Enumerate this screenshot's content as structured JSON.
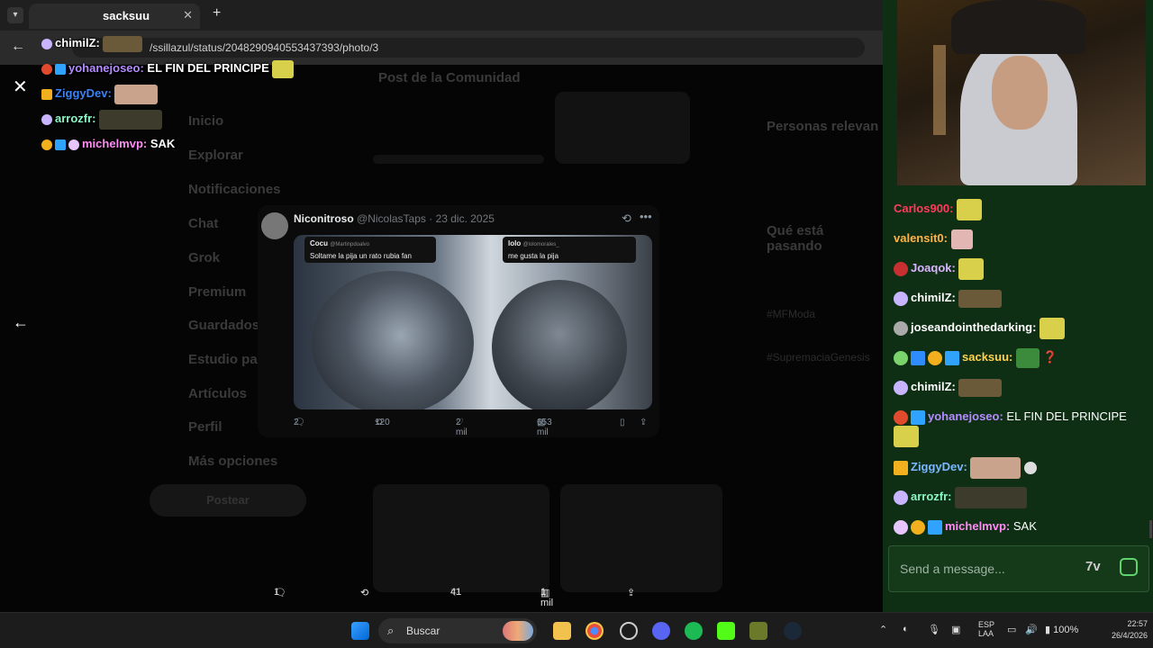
{
  "browser": {
    "tab_title": "sacksuu",
    "new_tab": "+",
    "url": "/ssillazul/status/2048290940553437393/photo/3"
  },
  "x_page": {
    "sidebar": [
      "Inicio",
      "Explorar",
      "Notificaciones",
      "Chat",
      "Grok",
      "Premium",
      "Guardados",
      "Estudio pa",
      "Artículos",
      "Perfil",
      "Más opciones"
    ],
    "post_button": "Postear",
    "community_title": "Post de la Comunidad",
    "right_titles": [
      "Personas relevan",
      "Qué está pasando"
    ],
    "trend_tags": [
      "#MFModa",
      "#SupremaciaGenesis"
    ]
  },
  "tweet": {
    "name": "Niconitroso",
    "handle": "@NicolasTaps",
    "date": "· 23 dic. 2025",
    "image": {
      "left_name": "Cocu",
      "left_handle": "@Martinpdoalvo",
      "left_text": "Soltame la pija un rato rubia fan",
      "right_name": "lolo",
      "right_handle": "@lolomorales_",
      "right_text": "me gusta la pija"
    },
    "replies": "2",
    "reposts": "120",
    "likes": "2 mil",
    "views": "653 mil"
  },
  "post_actions": {
    "replies": "1",
    "likes": "41",
    "views": "1 mil"
  },
  "overlay_chat": [
    {
      "user": "chimilZ:",
      "color": "#ffffff",
      "msg": ""
    },
    {
      "user": "yohanejoseo:",
      "color": "#b48cff",
      "msg": "EL FIN DEL PRINCIPE"
    },
    {
      "user": "ZiggyDev:",
      "color": "#3b82f6",
      "msg": ""
    },
    {
      "user": "arrozfr:",
      "color": "#8cf5c4",
      "msg": ""
    },
    {
      "user": "michelmvp:",
      "color": "#ff8cf5",
      "msg": "SAK"
    }
  ],
  "chat": [
    {
      "user": "Carlos900:",
      "color": "#ff3b5c",
      "msg": ""
    },
    {
      "user": "valensit0:",
      "color": "#ffb347",
      "msg": ""
    },
    {
      "user": "Joaqok:",
      "color": "#d8b4ff",
      "msg": ""
    },
    {
      "user": "chimilZ:",
      "color": "#ffffff",
      "msg": ""
    },
    {
      "user": "joseandointhedarking:",
      "color": "#ffffff",
      "msg": ""
    },
    {
      "user": "sacksuu:",
      "color": "#ffd24d",
      "msg": "❓"
    },
    {
      "user": "chimilZ:",
      "color": "#ffffff",
      "msg": ""
    },
    {
      "user": "yohanejoseo:",
      "color": "#b48cff",
      "msg": "EL FIN DEL PRINCIPE"
    },
    {
      "user": "ZiggyDev:",
      "color": "#7ab8ff",
      "msg": ""
    },
    {
      "user": "arrozfr:",
      "color": "#8cf5c4",
      "msg": ""
    },
    {
      "user": "michelmvp:",
      "color": "#ff8cf5",
      "msg": "SAK"
    }
  ],
  "chat_input": {
    "placeholder": "Send a message..."
  },
  "taskbar": {
    "search_label": "Buscar",
    "lang_1": "ESP",
    "lang_2": "LAA",
    "battery": "100%",
    "time": "22:57",
    "date": "26/4/2026"
  }
}
